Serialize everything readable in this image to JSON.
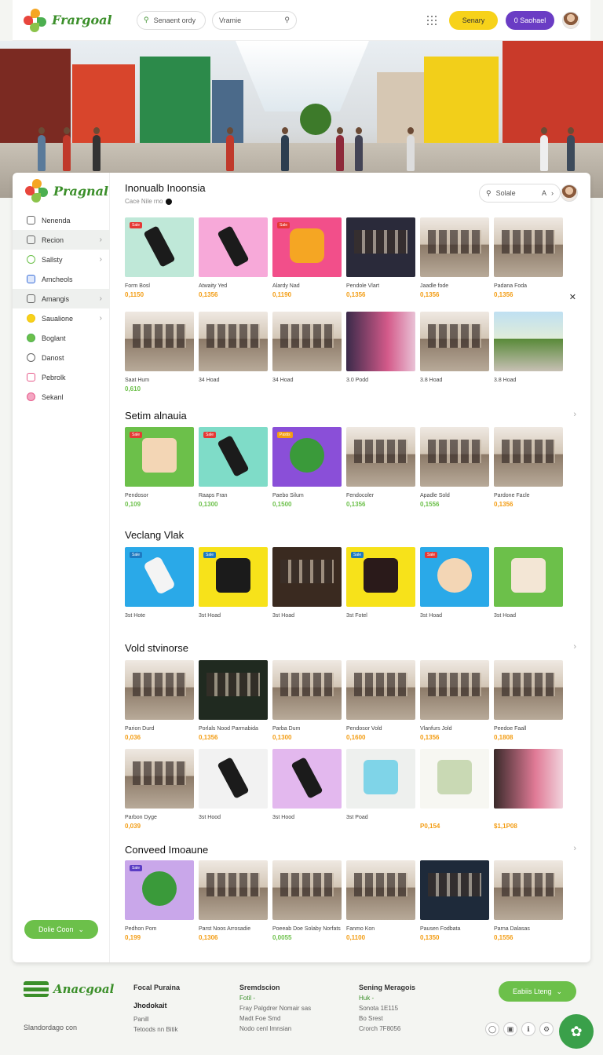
{
  "header": {
    "brand": "Frargoal",
    "search1_label": "Senaent ordy",
    "search2_label": "Vramie",
    "yellow_button": "Senary",
    "purple_button": "0 Saohael"
  },
  "sidebar": {
    "brand": "Pragnal",
    "items": [
      {
        "label": "Nenenda",
        "chevron": false,
        "active": false
      },
      {
        "label": "Recion",
        "chevron": true,
        "active": true
      },
      {
        "label": "Sallsty",
        "chevron": true,
        "active": false
      },
      {
        "label": "Amcheols",
        "chevron": false,
        "active": false
      },
      {
        "label": "Amangis",
        "chevron": true,
        "active": true
      },
      {
        "label": "Saualione",
        "chevron": true,
        "active": false
      },
      {
        "label": "Boglant",
        "chevron": false,
        "active": false
      },
      {
        "label": "Danost",
        "chevron": false,
        "active": false
      },
      {
        "label": "Pebrolk",
        "chevron": false,
        "active": false
      },
      {
        "label": "Sekanl",
        "chevron": false,
        "active": false
      }
    ],
    "bottom_button": "Dolie Coon"
  },
  "content": {
    "title": "Inonualb Inoonsia",
    "subtitle": "Cace Nile rno",
    "search_label": "Solale",
    "sections": [
      {
        "title": "Setim alnauia"
      },
      {
        "title": "Veclang Vlak"
      },
      {
        "title": "Vold stvinorse"
      },
      {
        "title": "Conveed Imoaune"
      }
    ]
  },
  "rows": {
    "r1": [
      {
        "name": "Form Bosl",
        "price": "0,1150",
        "badge": "Sale"
      },
      {
        "name": "Atwaity Yed",
        "price": "0,1356",
        "badge": ""
      },
      {
        "name": "Alardy Nad",
        "price": "0,1190",
        "badge": "Sale"
      },
      {
        "name": "Pendole Vlart",
        "price": "0,1356",
        "badge": ""
      },
      {
        "name": "Jaadle fode",
        "price": "0,1356",
        "badge": ""
      },
      {
        "name": "Padana Foda",
        "price": "0,1356",
        "badge": ""
      }
    ],
    "r2": [
      {
        "name": "Saat Hum",
        "price": "0,610"
      },
      {
        "name": "34 Hoad",
        "price": ""
      },
      {
        "name": "34 Hoad",
        "price": ""
      },
      {
        "name": "3.0 Podd",
        "price": ""
      },
      {
        "name": "3.8 Hoad",
        "price": ""
      },
      {
        "name": "3.8 Hoad",
        "price": ""
      }
    ],
    "r3": [
      {
        "name": "Pendosor",
        "price": "0,109",
        "badge": "Sale"
      },
      {
        "name": "Raaps Fran",
        "price": "0,1300",
        "badge": "Sale"
      },
      {
        "name": "Paebo Silum",
        "price": "0,1500",
        "badge": "Pastis"
      },
      {
        "name": "Fendocoler",
        "price": "0,1356",
        "badge": ""
      },
      {
        "name": "Apadle Sold",
        "price": "0,1556",
        "badge": ""
      },
      {
        "name": "Pardone Facle",
        "price": "0,1356",
        "badge": ""
      }
    ],
    "r4": [
      {
        "name": "3st Hote",
        "badge": "Sale"
      },
      {
        "name": "3st Hoad",
        "badge": "Sale"
      },
      {
        "name": "3st Hoad",
        "badge": ""
      },
      {
        "name": "3st Fotel",
        "badge": "Sale"
      },
      {
        "name": "3st Hoad",
        "badge": "Sale"
      },
      {
        "name": "3st Hoad",
        "badge": ""
      }
    ],
    "r5": [
      {
        "name": "Parion Durd",
        "price": "0,036"
      },
      {
        "name": "Porlals Nood Parmabida",
        "price": "0,1356"
      },
      {
        "name": "Parba Dum",
        "price": "0,1300"
      },
      {
        "name": "Pendosor Vold",
        "price": "0,1600"
      },
      {
        "name": "Vlanfurs Jold",
        "price": "0,1356"
      },
      {
        "name": "Peedoe Faall",
        "price": "0,1808"
      }
    ],
    "r6": [
      {
        "name": "Parbon Dyge",
        "price": "0,039"
      },
      {
        "name": "3st Hood",
        "price": ""
      },
      {
        "name": "3st Hood",
        "price": ""
      },
      {
        "name": "3st Poad",
        "price": ""
      },
      {
        "name": "",
        "price": "P0,154"
      },
      {
        "name": "",
        "price": "$1,1P08"
      }
    ],
    "r7": [
      {
        "name": "Pedhon Pom",
        "price": "0,199",
        "badge": "Sale"
      },
      {
        "name": "Parst Noos Arrosadie",
        "price": "0,1306",
        "badge": ""
      },
      {
        "name": "Poeeab Doe Solaby Norfats",
        "price": "0,0055",
        "badge": ""
      },
      {
        "name": "Fanmo Kon",
        "price": "0,1100",
        "badge": ""
      },
      {
        "name": "Pausen Fodbata",
        "price": "0,1350",
        "badge": ""
      },
      {
        "name": "Parna Dalasas",
        "price": "0,1556",
        "badge": ""
      }
    ]
  },
  "footer": {
    "brand": "Anacgoal",
    "copyright": "Slandordago con",
    "col1": {
      "title": "Focal Puraina",
      "line1": "Jhodokait",
      "line2": "Panill",
      "line3": "Tetoods nn Bitik"
    },
    "col2": {
      "title": "Sremdscion",
      "line1": "Fotil -",
      "line2": "Fray Palgdrer Nomair sas",
      "line3": "Madt  Foe Smd",
      "line4": "Nodo cenl Imnsian"
    },
    "col3": {
      "title": "Sening Meragois",
      "line1": "Huk -",
      "line2": "Sonota 1E115",
      "line3": "Bo Srest",
      "line4": "Crorch 7F8056"
    },
    "button": "Eabiis Lteng"
  }
}
